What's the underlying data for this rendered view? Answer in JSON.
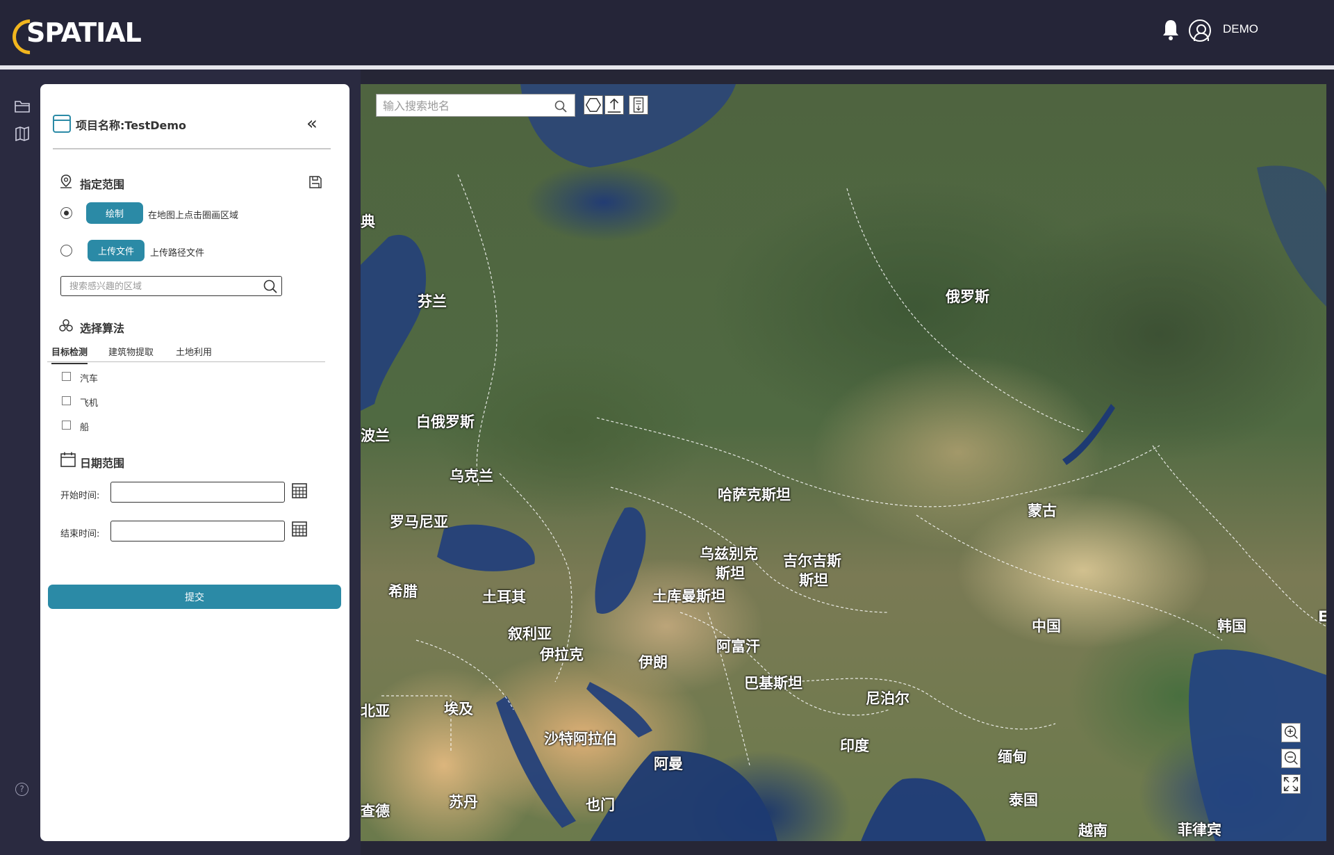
{
  "header": {
    "logo_text": "SPATIAL",
    "username": "DEMO"
  },
  "icons": {
    "bell": "bell-icon",
    "user": "user-circle-icon",
    "rail": [
      "folder-icon",
      "map-book-icon"
    ],
    "help": "help-icon"
  },
  "panel": {
    "project_title": "项目名称:TestDemo",
    "collapse_glyph": "«",
    "range": {
      "title": "指定范围",
      "options": [
        {
          "button": "绘制",
          "hint": "在地图上点击圈画区域",
          "selected": true
        },
        {
          "button": "上传文件",
          "hint": "上传路径文件",
          "selected": false
        }
      ],
      "search_placeholder": "搜索感兴趣的区域"
    },
    "algorithm": {
      "title": "选择算法",
      "tabs": [
        "目标检测",
        "建筑物提取",
        "土地利用"
      ],
      "active_tab": 0,
      "options": [
        "汽车",
        "飞机",
        "船"
      ]
    },
    "dates": {
      "title": "日期范围",
      "start_label": "开始时间:",
      "end_label": "结束时间:",
      "start_value": "",
      "end_value": ""
    },
    "submit_label": "提交"
  },
  "map": {
    "search_placeholder": "输入搜索地名",
    "tools": [
      "polygon-draw-icon",
      "upload-icon",
      "layer-legend-icon"
    ],
    "zoom_controls": [
      "zoom-in-icon",
      "zoom-out-icon",
      "fullscreen-icon"
    ],
    "labels": [
      "典",
      "芬兰",
      "俄罗斯",
      "白俄罗斯",
      "波兰",
      "乌克兰",
      "哈萨克斯坦",
      "蒙古",
      "罗马尼亚",
      "乌兹别克",
      "斯坦",
      "吉尔吉斯",
      "斯坦",
      "希腊",
      "土耳其",
      "土库曼斯坦",
      "中国",
      "韩国",
      "叙利亚",
      "伊拉克",
      "伊朗",
      "阿富汗",
      "巴基斯坦",
      "尼泊尔",
      "北亚",
      "埃及",
      "沙特阿拉伯",
      "阿曼",
      "印度",
      "缅甸",
      "泰国",
      "苏丹",
      "也门",
      "查德",
      "越南",
      "菲律宾",
      "E"
    ]
  },
  "colors": {
    "accent": "#2b8aa6",
    "header_bg": "#252538",
    "logo_arc": "#f2b61e"
  }
}
